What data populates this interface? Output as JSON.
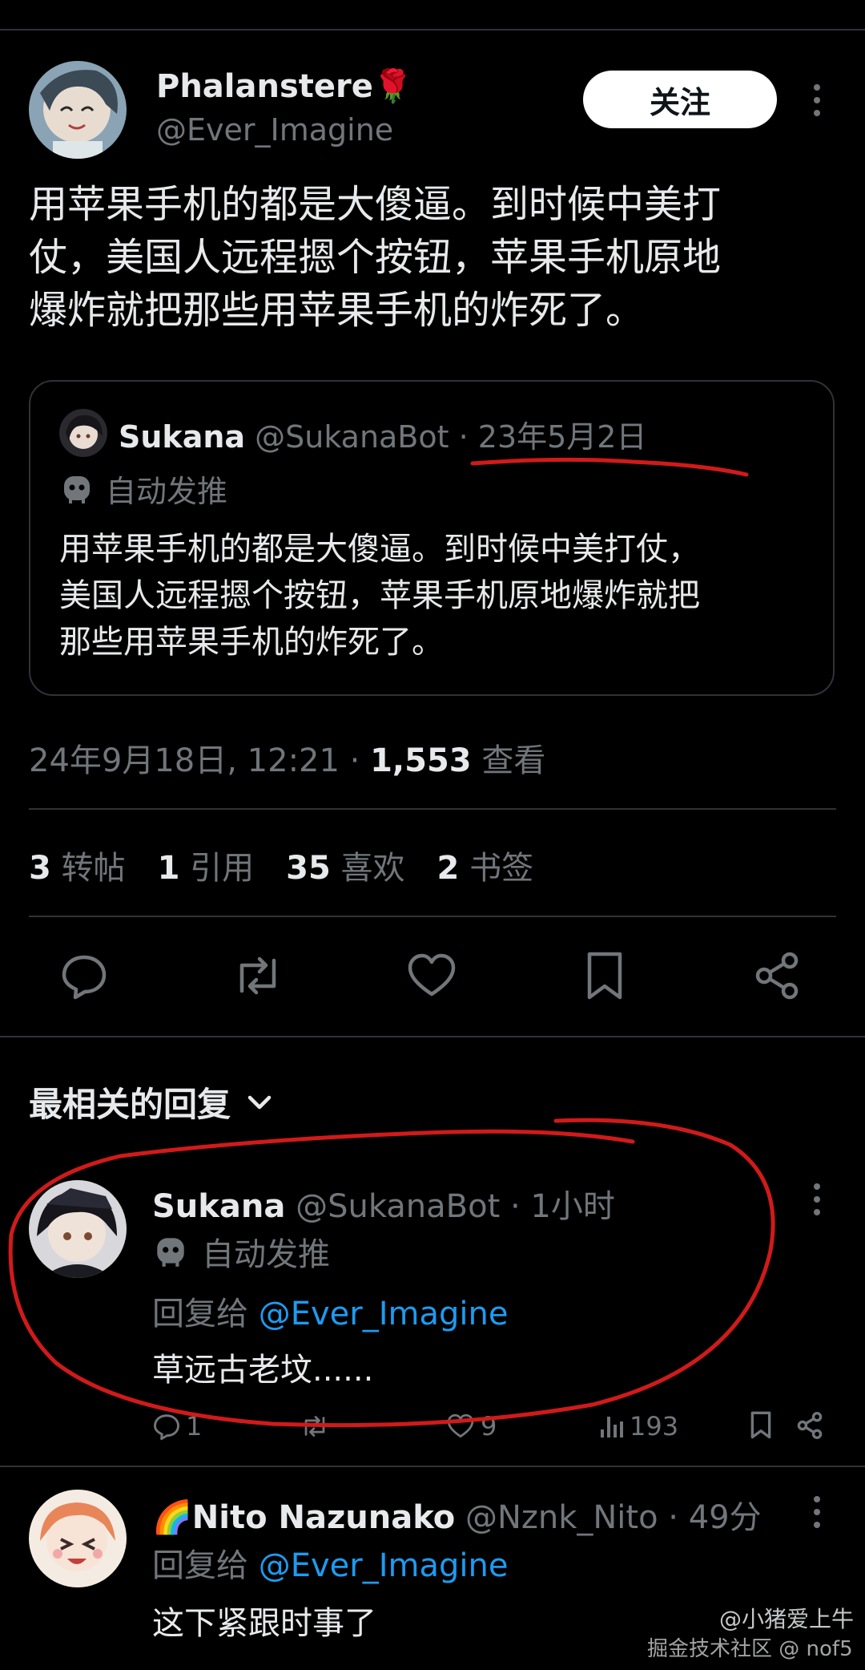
{
  "tweet": {
    "author_name": "Phalanstere🌹",
    "author_handle": "@Ever_Imagine",
    "follow_label": "关注",
    "body_lines": [
      "用苹果手机的都是大傻逼。到时候中美打",
      "仗，美国人远程摁个按钮，苹果手机原地",
      "爆炸就把那些用苹果手机的炸死了。"
    ],
    "timestamp": "24年9月18日, 12:21 · ",
    "views_count": "1,553",
    "views_label": " 查看"
  },
  "quote": {
    "name": "Sukana",
    "handle_date": " @SukanaBot · 23年5月2日",
    "auto_label": "自动发推",
    "body_lines": [
      "用苹果手机的都是大傻逼。到时候中美打仗，",
      "美国人远程摁个按钮，苹果手机原地爆炸就把",
      "那些用苹果手机的炸死了。"
    ]
  },
  "stats": [
    {
      "count": "3",
      "label": "转帖"
    },
    {
      "count": "1",
      "label": "引用"
    },
    {
      "count": "35",
      "label": "喜欢"
    },
    {
      "count": "2",
      "label": "书签"
    }
  ],
  "replies_header": "最相关的回复",
  "reply1": {
    "name": "Sukana",
    "handle_time": " @SukanaBot · 1小时",
    "auto_label": "自动发推",
    "reply_to_prefix": "回复给 ",
    "reply_to_handle": "@Ever_Imagine",
    "body": "草远古老坟......",
    "reply_count": "1",
    "like_count": "9",
    "view_count": "193"
  },
  "reply2": {
    "name": "🌈Nito Nazunako",
    "handle_time": " @Nznk_Nito · 49分",
    "reply_to_prefix": "回复给 ",
    "reply_to_handle": "@Ever_Imagine",
    "body": "这下紧跟时事了"
  },
  "watermark": {
    "line1": "@小猪爱上牛",
    "line2": "掘金技术社区 @ nof5"
  },
  "colors": {
    "background": "#000000",
    "text": "#e7e9ea",
    "muted": "#71767b",
    "link": "#1d9bf0",
    "annotation": "#d11a1a"
  }
}
